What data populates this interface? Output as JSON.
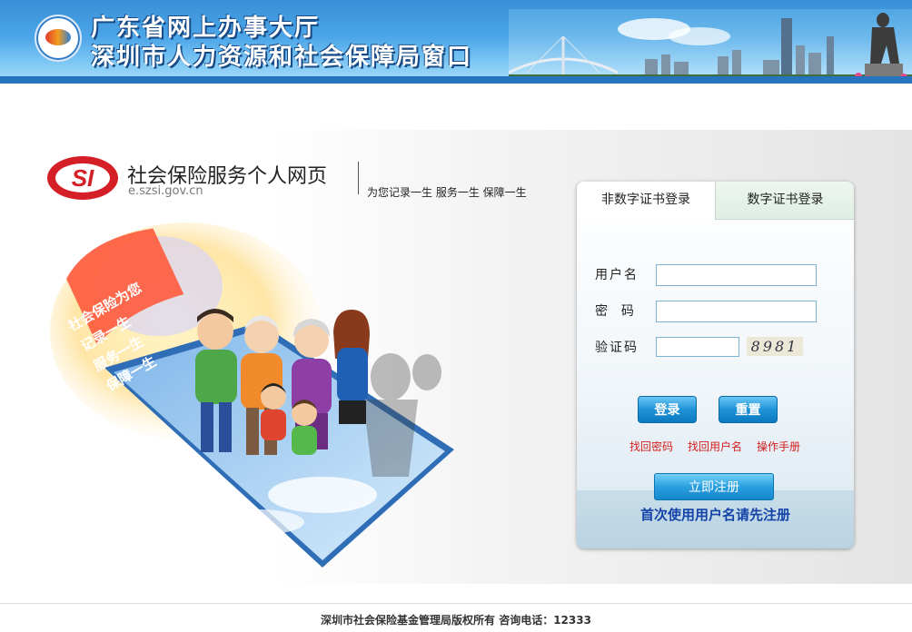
{
  "banner": {
    "title_line1": "广东省网上办事大厅",
    "title_line2": "深圳市人力资源和社会保障局窗口"
  },
  "brand": {
    "logo_text": "SI",
    "title": "社会保险服务个人网页",
    "domain": "e.szsi.gov.cn",
    "slogan": "为您记录一生  服务一生  保障一生"
  },
  "illustration": {
    "banner_lines": [
      "社会保险为您",
      "记录一生",
      "服务一生",
      "保障一生"
    ]
  },
  "login": {
    "tabs": [
      {
        "label": "非数字证书登录",
        "active": true
      },
      {
        "label": "数字证书登录",
        "active": false
      }
    ],
    "fields": {
      "username_label": "用户名",
      "password_label": "密  码",
      "captcha_label": "验证码",
      "username_value": "",
      "password_value": "",
      "captcha_value": "",
      "captcha_image_text": "8981"
    },
    "buttons": {
      "login": "登录",
      "reset": "重置",
      "register": "立即注册"
    },
    "links": [
      "找回密码",
      "找回用户名",
      "操作手册"
    ],
    "register_hint": "首次使用用户名请先注册"
  },
  "footer": {
    "text": "深圳市社会保险基金管理局版权所有 咨询电话：12333"
  },
  "colors": {
    "banner_blue": "#3a8fd6",
    "link_red": "#d31e1e",
    "hint_blue": "#1544a8",
    "button_blue": "#1f93d8"
  }
}
